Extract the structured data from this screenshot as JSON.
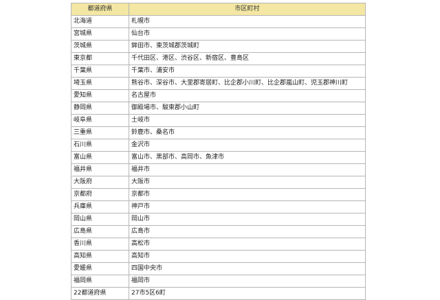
{
  "table": {
    "headers": [
      "都道府県",
      "市区町村"
    ],
    "rows": [
      [
        "北海道",
        "札幌市"
      ],
      [
        "宮城県",
        "仙台市"
      ],
      [
        "茨城県",
        "鉾田市、東茨城郡茨城町"
      ],
      [
        "東京都",
        "千代田区、港区、渋谷区、新宿区、豊島区"
      ],
      [
        "千葉県",
        "千葉市、浦安市"
      ],
      [
        "埼玉県",
        "熊谷市、深谷市、大里郡寄居町、比企郡小川町、比企郡嵐山町、児玉郡神川町"
      ],
      [
        "愛知県",
        "名古屋市"
      ],
      [
        "静岡県",
        "御殿場市、駿東郡小山町"
      ],
      [
        "岐阜県",
        "土岐市"
      ],
      [
        "三重県",
        "鈴鹿市、桑名市"
      ],
      [
        "石川県",
        "金沢市"
      ],
      [
        "富山県",
        "富山市、黒部市、高岡市、魚津市"
      ],
      [
        "福井県",
        "福井市"
      ],
      [
        "大阪府",
        "大阪市"
      ],
      [
        "京都府",
        "京都市"
      ],
      [
        "兵庫県",
        "神戸市"
      ],
      [
        "岡山県",
        "岡山市"
      ],
      [
        "広島県",
        "広島市"
      ],
      [
        "香川県",
        "高松市"
      ],
      [
        "高知県",
        "高知市"
      ],
      [
        "愛媛県",
        "四国中央市"
      ],
      [
        "福岡県",
        "福岡市"
      ],
      [
        "22都道府県",
        "27市5区6町"
      ]
    ]
  },
  "colors": {
    "header_bg": "#f3e7a3",
    "border": "#b5b5b5"
  }
}
